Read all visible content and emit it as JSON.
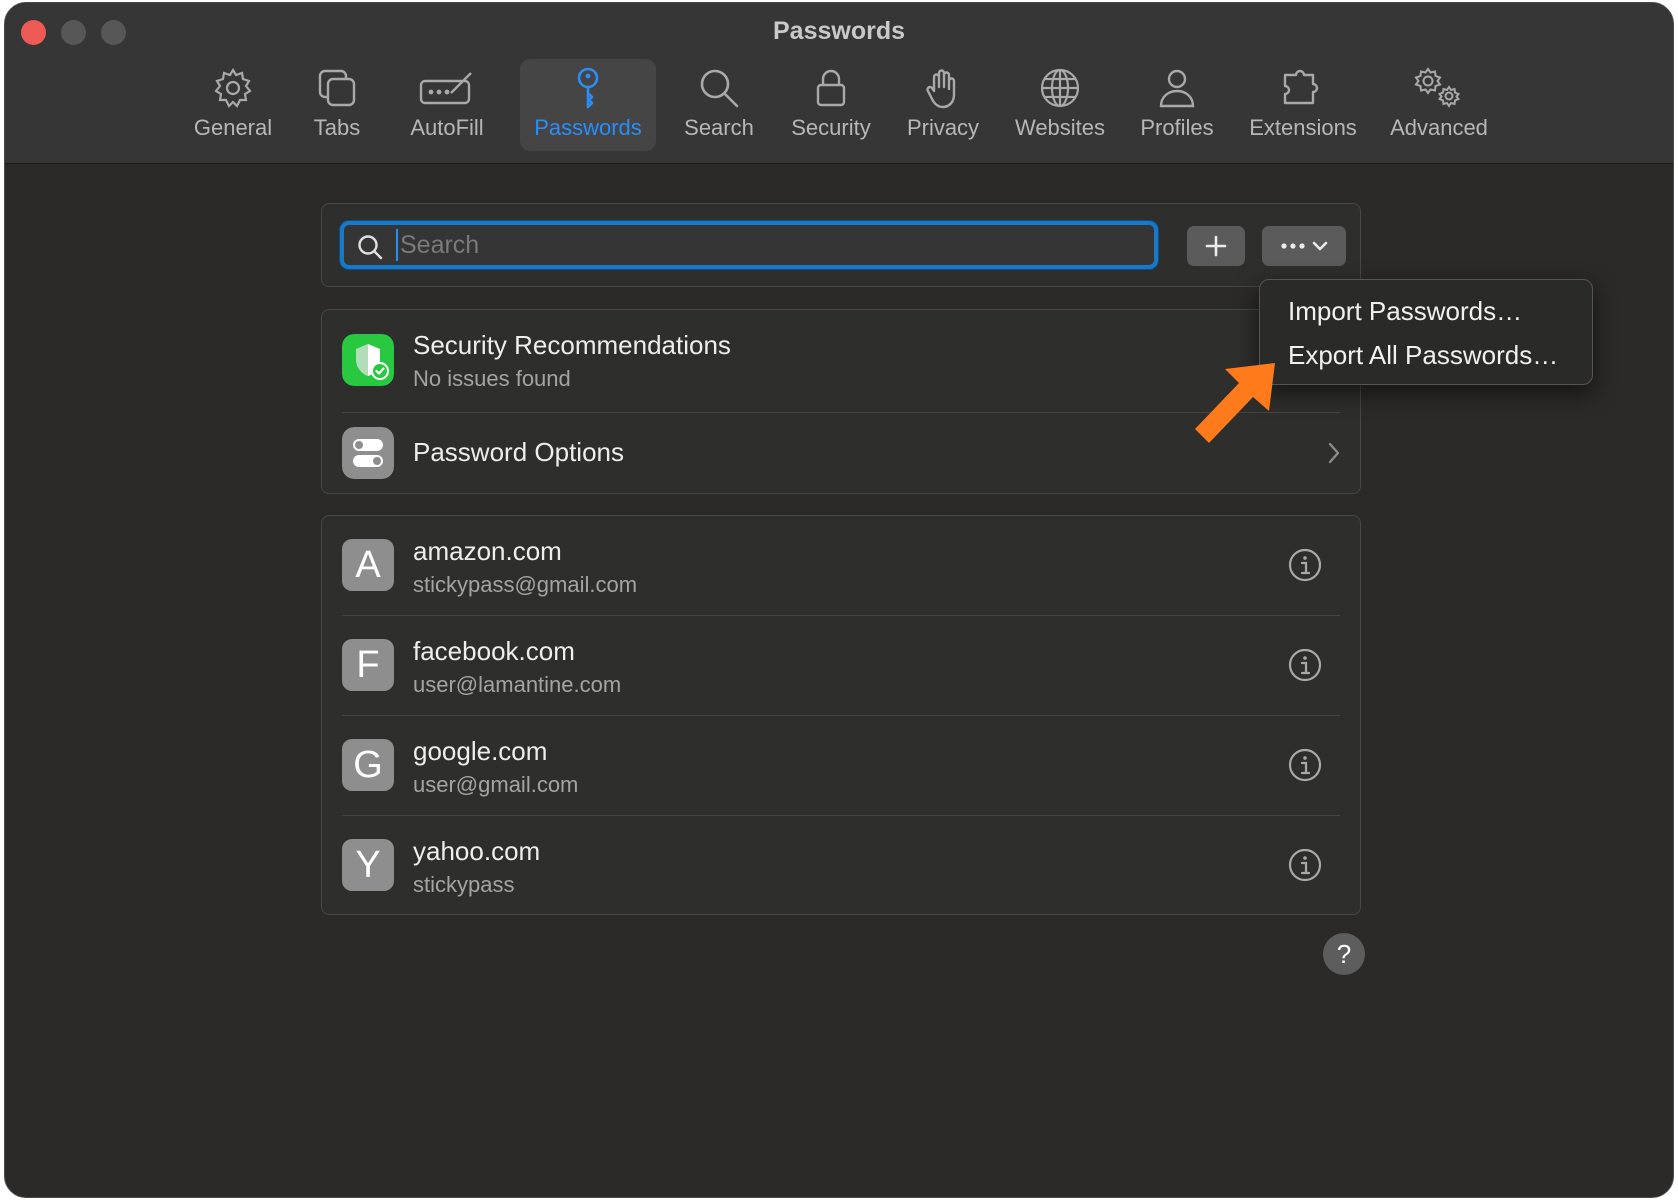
{
  "window": {
    "title": "Passwords"
  },
  "toolbar": {
    "items": [
      {
        "label": "General",
        "icon": "gear-icon"
      },
      {
        "label": "Tabs",
        "icon": "tabs-icon"
      },
      {
        "label": "AutoFill",
        "icon": "autofill-icon"
      },
      {
        "label": "Passwords",
        "icon": "key-icon",
        "active": true
      },
      {
        "label": "Search",
        "icon": "search-icon"
      },
      {
        "label": "Security",
        "icon": "lock-icon"
      },
      {
        "label": "Privacy",
        "icon": "hand-icon"
      },
      {
        "label": "Websites",
        "icon": "globe-icon"
      },
      {
        "label": "Profiles",
        "icon": "person-icon"
      },
      {
        "label": "Extensions",
        "icon": "puzzle-icon"
      },
      {
        "label": "Advanced",
        "icon": "gears-icon"
      }
    ]
  },
  "search": {
    "placeholder": "Search",
    "value": ""
  },
  "recommendations": {
    "title": "Security Recommendations",
    "subtitle": "No issues found",
    "options_label": "Password Options"
  },
  "passwords": [
    {
      "letter": "A",
      "site": "amazon.com",
      "user": "stickypass@gmail.com"
    },
    {
      "letter": "F",
      "site": "facebook.com",
      "user": "user@lamantine.com"
    },
    {
      "letter": "G",
      "site": "google.com",
      "user": "user@gmail.com"
    },
    {
      "letter": "Y",
      "site": "yahoo.com",
      "user": "stickypass"
    }
  ],
  "menu": {
    "import_label": "Import Passwords…",
    "export_label": "Export All Passwords…"
  },
  "help": {
    "label": "?"
  },
  "colors": {
    "accent": "#2b8ef6",
    "security_green": "#28c840",
    "annotation_arrow": "#ff7a1a"
  }
}
